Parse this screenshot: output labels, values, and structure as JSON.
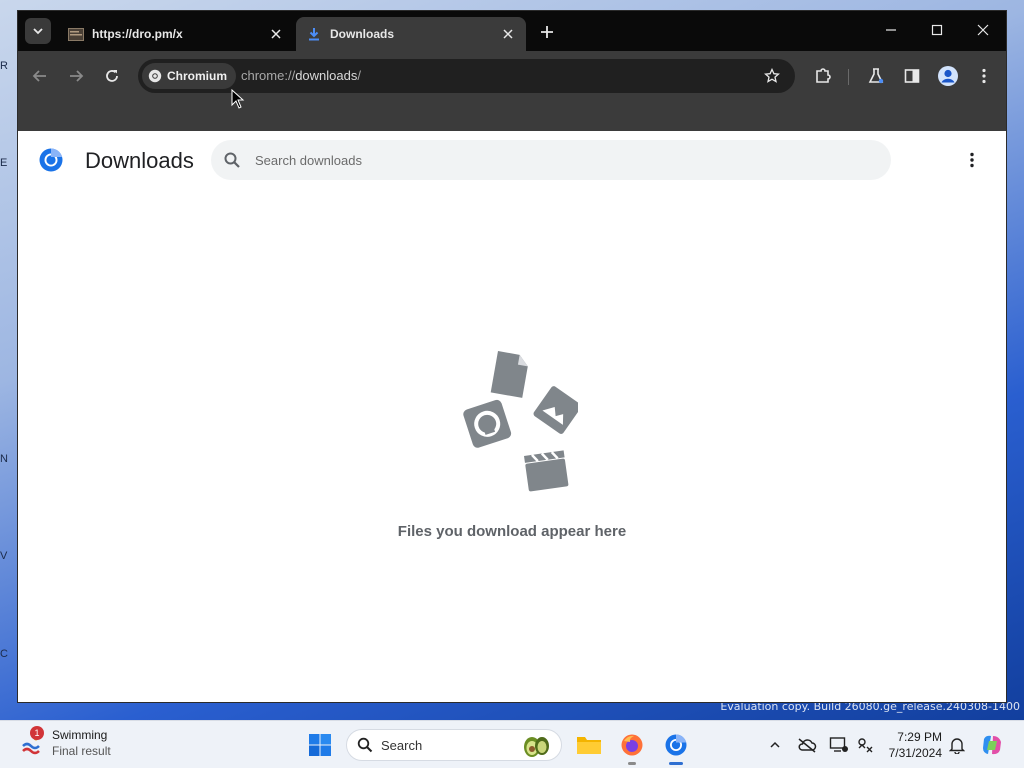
{
  "browser": {
    "tabs": [
      {
        "title": "https://dro.pm/x",
        "active": false
      },
      {
        "title": "Downloads",
        "active": true
      }
    ],
    "address_bar": {
      "chip_label": "Chromium",
      "url_scheme": "chrome://",
      "url_host": "downloads",
      "url_tail": "/"
    }
  },
  "page": {
    "title": "Downloads",
    "search_placeholder": "Search downloads",
    "empty_message": "Files you download appear here"
  },
  "desktop": {
    "watermark_line1": "Evaluation copy. Build 26080.ge_release.240308-1400"
  },
  "taskbar": {
    "weather": {
      "title": "Swimming",
      "subtitle": "Final result",
      "badge": "1"
    },
    "search_label": "Search",
    "time": "7:29 PM",
    "date": "7/31/2024"
  },
  "colors": {
    "tabstrip": "#0a0a0a",
    "toolbar": "#3b3b3b",
    "accent": "#1a73e8",
    "illustration": "#80868b"
  }
}
